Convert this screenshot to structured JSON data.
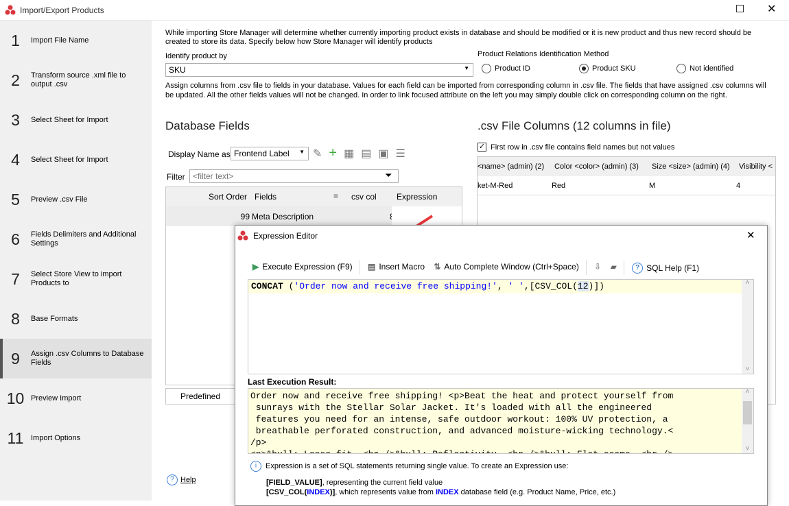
{
  "window": {
    "title": "Import/Export Products"
  },
  "steps": [
    {
      "num": "1",
      "label": "Import File Name"
    },
    {
      "num": "2",
      "label": "Transform source .xml file to output .csv"
    },
    {
      "num": "3",
      "label": "Select Sheet for Import"
    },
    {
      "num": "4",
      "label": "Select Sheet for Import"
    },
    {
      "num": "5",
      "label": "Preview .csv File"
    },
    {
      "num": "6",
      "label": "Fields Delimiters and Additional Settings"
    },
    {
      "num": "7",
      "label": "Select Store View to import Products to"
    },
    {
      "num": "8",
      "label": "Base Formats"
    },
    {
      "num": "9",
      "label": "Assign .csv Columns to Database Fields",
      "selected": true
    },
    {
      "num": "10",
      "label": "Preview Import"
    },
    {
      "num": "11",
      "label": "Import Options"
    }
  ],
  "help_label": "Help",
  "intro": "While importing Store Manager will determine whether currently importing product exists in database and should be modified or it is new product and thus new record should be created to store its data. Specify below how Store Manager will identify products",
  "identify": {
    "label": "Identify product by",
    "value": "SKU"
  },
  "relations": {
    "label": "Product Relations Identification Method",
    "options": [
      "Product ID",
      "Product SKU",
      "Not identified"
    ],
    "selected": "Product SKU"
  },
  "assign_text": "Assign columns from .csv file to fields in your database. Values for each field can be imported from corresponding column in .csv file. The fields that have assigned .csv columns will be updated. All the other fields values will not be changed. In order to link focused attribute on the left you may simply double click on corresponding column on the right.",
  "db_fields": {
    "title": "Database Fields",
    "display_name_label": "Display Name as",
    "display_name_value": "Frontend Label",
    "filter_label": "Filter",
    "filter_placeholder": "<filter text>",
    "columns": [
      "Sort Order",
      "Fields",
      "csv col",
      "Expression"
    ],
    "rows": [
      {
        "sort": "99",
        "field": "Meta Description",
        "csv": "8",
        "expr": ""
      }
    ],
    "predefined_label": "Predefined"
  },
  "csv": {
    "title": ".csv File Columns (12 columns in file)",
    "first_row_label": "First row in .csv file contains field names but not values",
    "first_row_checked": true,
    "columns": [
      "<name> (admin) (2)",
      "Color <color> (admin) (3)",
      "Size <size> (admin) (4)",
      "Visibility <"
    ],
    "rows": [
      [
        "ket-M-Red",
        "Red",
        "M",
        "4"
      ]
    ]
  },
  "dialog": {
    "title": "Expression Editor",
    "toolbar": {
      "execute": "Execute Expression (F9)",
      "macro": "Insert Macro",
      "autocomplete": "Auto Complete Window (Ctrl+Space)",
      "sql_help": "SQL Help (F1)"
    },
    "expression": {
      "func": "CONCAT",
      "open": " (",
      "str1": "'Order now and receive free shipping!'",
      "mid": ", ",
      "str2": "' '",
      "tail1": ",[CSV_COL(",
      "arg": "12",
      "tail2": ")])"
    },
    "result_label": "Last Execution Result:",
    "result_lines": [
      "Order now and receive free shipping! <p>Beat the heat and protect yourself from",
      " sunrays with the Stellar Solar Jacket. It's loaded with all the engineered",
      " features you need for an intense, safe outdoor workout: 100% UV protection, a",
      " breathable perforated construction, and advanced moisture-wicking technology.<",
      "/p>",
      "<p>&bull; Loose fit. <br />&bull; Reflectivity. <br />&bull; Flat seams. <br />"
    ],
    "info": "Expression is a set of SQL statements returning single value. To create an Expression use:",
    "hint1_code": "[FIELD_VALUE]",
    "hint1_text": ", representing the current field value",
    "hint2_a": "[CSV_COL(",
    "hint2_b": "INDEX",
    "hint2_c": ")]",
    "hint2_d": ", which represents value from ",
    "hint2_e": "INDEX",
    "hint2_f": " database field (e.g. Product Name, Price, etc.)"
  },
  "colors": {
    "accent": "#d9363e",
    "string": "#0000ff",
    "editor_bg": "#ffffe0",
    "arrow": "#e8383d"
  }
}
